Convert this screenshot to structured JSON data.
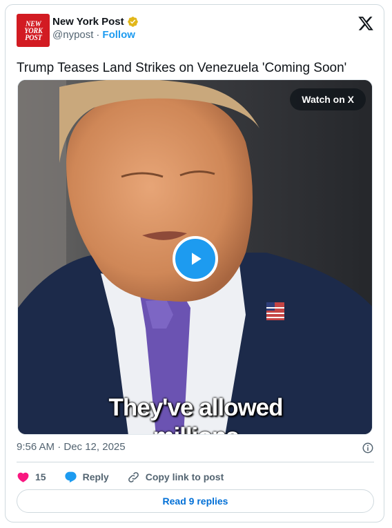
{
  "author": {
    "avatar_text": [
      "NEW",
      "YORK",
      "POST"
    ],
    "display_name": "New York Post",
    "handle": "@nypost",
    "separator": "·",
    "follow_label": "Follow",
    "verified_icon": "verified-badge-icon",
    "verified_color": "#e2b719"
  },
  "platform_icon": "x-logo-icon",
  "tweet": {
    "text": "Trump Teases Land Strikes on Venezuela 'Coming Soon'"
  },
  "media": {
    "watch_label": "Watch on X",
    "play_icon": "play-icon",
    "caption_line1": "They've allowed",
    "caption_line2": "millions"
  },
  "meta": {
    "timestamp": "9:56 AM · Dec 12, 2025",
    "info_icon": "info-icon"
  },
  "actions": {
    "like_count": "15",
    "like_icon": "heart-icon",
    "like_color": "#f91880",
    "reply_label": "Reply",
    "reply_icon": "speech-bubble-icon",
    "reply_color": "#1d9bf0",
    "copy_label": "Copy link to post",
    "copy_icon": "link-icon"
  },
  "read_replies_label": "Read 9 replies",
  "colors": {
    "accent": "#1d9bf0",
    "link": "#006fd6",
    "muted": "#536471",
    "border": "#cfd9de",
    "brand_red": "#d21b22"
  }
}
